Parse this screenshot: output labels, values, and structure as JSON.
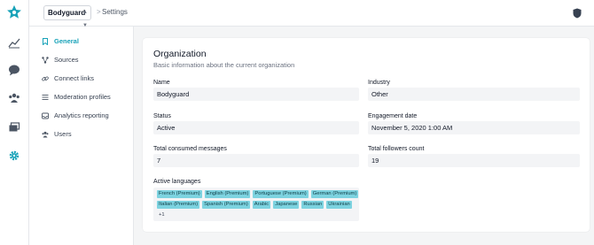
{
  "colors": {
    "accent": "#17a2b8",
    "chip_bg": "#7dd3e0",
    "page_bg": "#f4f5f6"
  },
  "rail": {
    "logo_icon": "star-logo-icon",
    "items": [
      {
        "icon": "analytics-icon"
      },
      {
        "icon": "chat-bubble-icon"
      },
      {
        "icon": "users-group-icon"
      },
      {
        "icon": "gallery-icon"
      },
      {
        "icon": "gear-icon",
        "active": true
      }
    ]
  },
  "topbar": {
    "org_selector": "Bodyguard",
    "breadcrumb_separator": ">",
    "breadcrumb": "Settings",
    "shield_icon": "shield-icon"
  },
  "sidenav": {
    "items": [
      {
        "label": "General",
        "icon": "bookmark-icon",
        "active": true
      },
      {
        "label": "Sources",
        "icon": "share-nodes-icon"
      },
      {
        "label": "Connect links",
        "icon": "link-icon"
      },
      {
        "label": "Moderation profiles",
        "icon": "sliders-icon"
      },
      {
        "label": "Analytics reporting",
        "icon": "inbox-icon"
      },
      {
        "label": "Users",
        "icon": "users-icon"
      }
    ]
  },
  "organization": {
    "title": "Organization",
    "subtitle": "Basic information about the current organization",
    "fields": {
      "name": {
        "label": "Name",
        "value": "Bodyguard"
      },
      "industry": {
        "label": "Industry",
        "value": "Other"
      },
      "status": {
        "label": "Status",
        "value": "Active"
      },
      "engagement_date": {
        "label": "Engagement date",
        "value": "November 5, 2020 1:00 AM"
      },
      "total_consumed_messages": {
        "label": "Total consumed messages",
        "value": "7"
      },
      "total_followers_count": {
        "label": "Total followers count",
        "value": "19"
      }
    },
    "active_languages": {
      "label": "Active languages",
      "chips": [
        "French (Premium)",
        "English (Premium)",
        "Portuguese (Premium)",
        "German (Premium)",
        "Italian (Premium)",
        "Spanish (Premium)",
        "Arabic",
        "Japanese",
        "Russian",
        "Ukrainian"
      ],
      "more": "+1"
    }
  }
}
